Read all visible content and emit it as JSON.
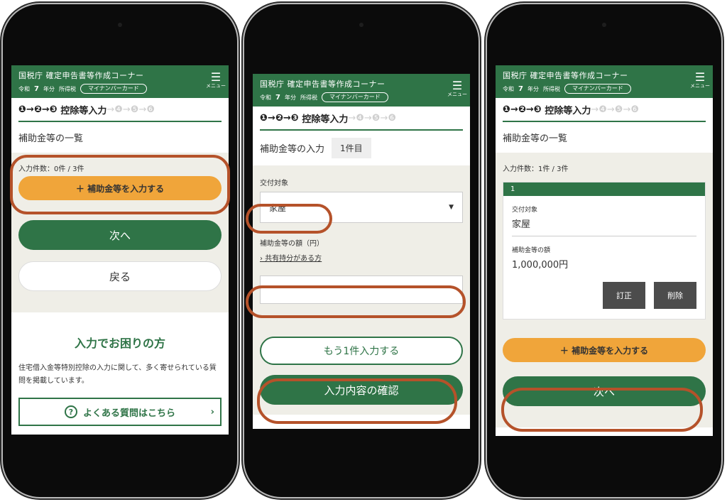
{
  "header": {
    "title": "国税庁 確定申告書等作成コーナー",
    "era": "令和",
    "year_num": "7",
    "year_unit": "年分",
    "tax_type": "所得税",
    "badge": "マイナンバーカード",
    "menu_label": "メニュー",
    "menu_icon": "hamburger-icon"
  },
  "steps": {
    "done": "❶→❷→❸",
    "current": "控除等入力",
    "rest": "→❹→❺→❻"
  },
  "screen1": {
    "page_title": "補助金等の一覧",
    "count": "入力件数：0件 / 3件",
    "add_button": "＋ 補助金等を入力する",
    "next_button": "次へ",
    "back_button": "戻る",
    "help_title": "入力でお困りの方",
    "help_text": "住宅借入金等特別控除の入力に関して、多く寄せられている質問を掲載しています。",
    "faq_button": "よくある質問はこちら",
    "faq_icon": "question-icon",
    "faq_chevron": "›"
  },
  "screen2": {
    "page_title": "補助金等の入力",
    "item_badge": "1件目",
    "target_label": "交付対象",
    "target_value": "家屋",
    "amount_label": "補助金等の額（円）",
    "shared_link": "› 共有持分がある方",
    "add_another_button": "もう1件入力する",
    "confirm_button": "入力内容の確認"
  },
  "screen3": {
    "page_title": "補助金等の一覧",
    "count": "入力件数：1件 / 3件",
    "card_number": "1",
    "target_label": "交付対象",
    "target_value": "家屋",
    "amount_label": "補助金等の額",
    "amount_value": "1,000,000円",
    "edit_button": "訂正",
    "delete_button": "削除",
    "add_button": "＋ 補助金等を入力する",
    "next_button": "次へ"
  }
}
